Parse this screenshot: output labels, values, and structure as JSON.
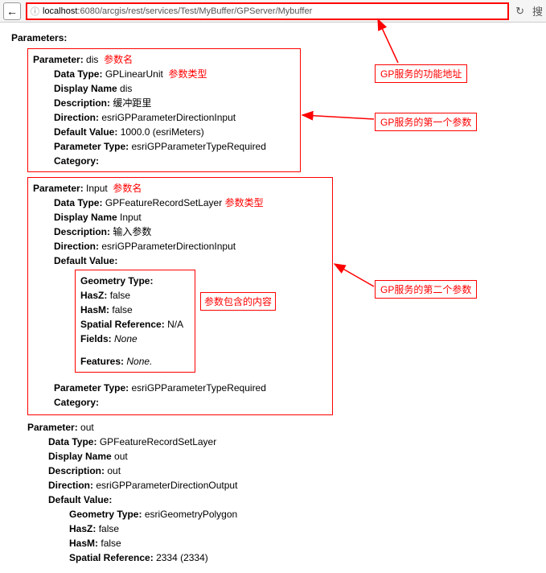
{
  "nav": {
    "url_prefix": "localhost",
    "url_rest": ":6080/arcgis/rest/services/Test/MyBuffer/GPServer/Mybuffer",
    "back_glyph": "←",
    "refresh_glyph": "↻",
    "search_glyph": "搜",
    "info_glyph": "ⓘ"
  },
  "callouts": {
    "c_url": "GP服务的功能地址",
    "c_p1": "GP服务的第一个参数",
    "c_inner": "参数包含的内容",
    "c_p2": "GP服务的第二个参数"
  },
  "heading": "Parameters:",
  "annotations": {
    "param_name": "参数名",
    "param_type": "参数类型"
  },
  "p1": {
    "param_label": "Parameter:",
    "param_value": "dis",
    "dt_label": "Data Type:",
    "dt_value": "GPLinearUnit",
    "dn_label": "Display Name",
    "dn_value": "dis",
    "desc_label": "Description:",
    "desc_value": "缓冲距里",
    "dir_label": "Direction:",
    "dir_value": "esriGPParameterDirectionInput",
    "def_label": "Default Value:",
    "def_value": "1000.0   (esriMeters)",
    "ptype_label": "Parameter Type:",
    "ptype_value": "esriGPParameterTypeRequired",
    "cat_label": "Category:"
  },
  "p2": {
    "param_label": "Parameter:",
    "param_value": "Input",
    "dt_label": "Data Type:",
    "dt_value": "GPFeatureRecordSetLayer",
    "dn_label": "Display Name",
    "dn_value": "Input",
    "desc_label": "Description:",
    "desc_value": "输入参数",
    "dir_label": "Direction:",
    "dir_value": "esriGPParameterDirectionInput",
    "def_label": "Default Value:",
    "geom": {
      "gt_label": "Geometry Type:",
      "hasz_label": "HasZ:",
      "hasz_value": "false",
      "hasm_label": "HasM:",
      "hasm_value": "false",
      "sr_label": "Spatial Reference:",
      "sr_value": "N/A",
      "fields_label": "Fields:",
      "fields_value": "None",
      "feat_label": "Features:",
      "feat_value": "None."
    },
    "ptype_label": "Parameter Type:",
    "ptype_value": "esriGPParameterTypeRequired",
    "cat_label": "Category:"
  },
  "p3": {
    "param_label": "Parameter:",
    "param_value": "out",
    "dt_label": "Data Type:",
    "dt_value": "GPFeatureRecordSetLayer",
    "dn_label": "Display Name",
    "dn_value": "out",
    "desc_label": "Description:",
    "desc_value": "out",
    "dir_label": "Direction:",
    "dir_value": "esriGPParameterDirectionOutput",
    "def_label": "Default Value:",
    "geom": {
      "gt_label": "Geometry Type:",
      "gt_value": "esriGeometryPolygon",
      "hasz_label": "HasZ:",
      "hasz_value": "false",
      "hasm_label": "HasM:",
      "hasm_value": "false",
      "sr_label": "Spatial Reference:",
      "sr_value": "2334  (2334)"
    }
  }
}
